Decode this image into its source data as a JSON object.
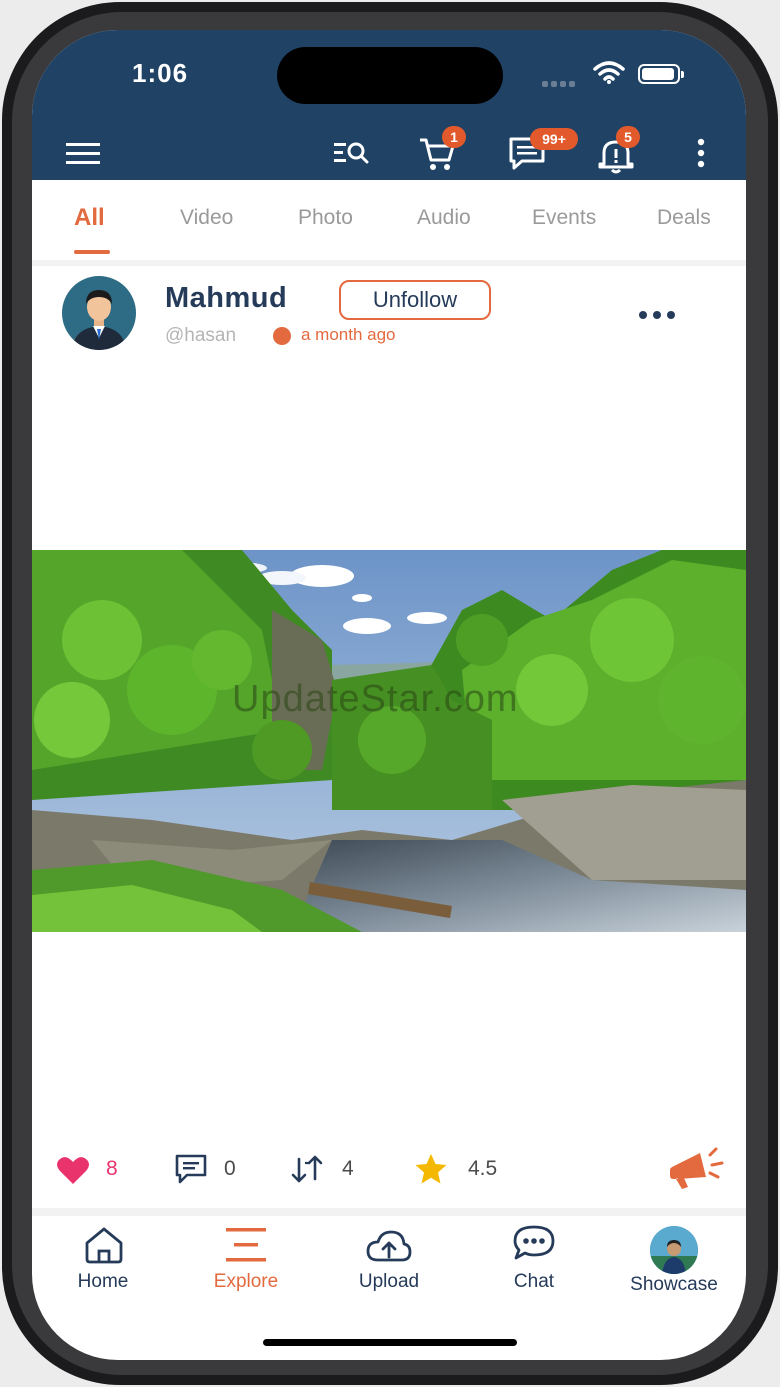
{
  "status": {
    "time": "1:06"
  },
  "toolbar": {
    "cart_badge": "1",
    "messages_badge": "99+",
    "notifications_badge": "5"
  },
  "tabs": [
    {
      "label": "All",
      "active": true
    },
    {
      "label": "Video"
    },
    {
      "label": "Photo"
    },
    {
      "label": "Audio"
    },
    {
      "label": "Events"
    },
    {
      "label": "Deals"
    }
  ],
  "post": {
    "author": "Mahmud",
    "follow_button": "Unfollow",
    "handle": "@hasan",
    "time_ago": "a month ago",
    "watermark": "UpdateStar.com",
    "stats": {
      "likes": "8",
      "comments": "0",
      "shares": "4",
      "rating": "4.5"
    }
  },
  "bottom_nav": [
    {
      "label": "Home",
      "active": false
    },
    {
      "label": "Explore",
      "active": true
    },
    {
      "label": "Upload",
      "active": false
    },
    {
      "label": "Chat",
      "active": false
    },
    {
      "label": "Showcase",
      "active": false
    }
  ],
  "colors": {
    "header": "#1f4265",
    "accent": "#e36a3e",
    "badge": "#e25a2c",
    "heart": "#e8336d",
    "star": "#f5b800",
    "text_dark": "#253b59"
  }
}
